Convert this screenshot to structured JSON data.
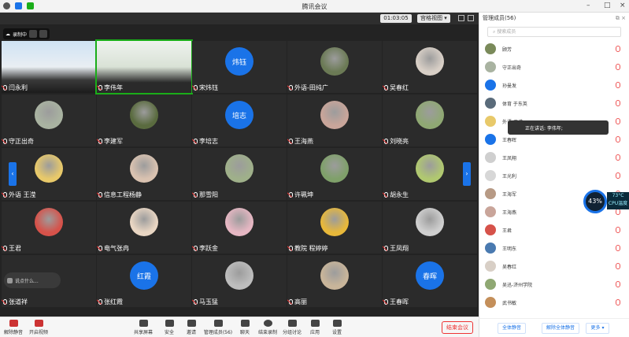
{
  "window": {
    "title": "腾讯会议",
    "timer": "01:03:05",
    "view_label": "宫格视图"
  },
  "recording": {
    "label": "录制中"
  },
  "tiles": [
    {
      "name": "闫永利",
      "type": "video",
      "bg": "video1"
    },
    {
      "name": "李伟年",
      "type": "video",
      "bg": "video2",
      "active": true
    },
    {
      "name": "宋炜钰",
      "type": "text",
      "avatar": "炜钰"
    },
    {
      "name": "外语-田纯广",
      "type": "photo",
      "c": "#6b7a55"
    },
    {
      "name": "吴春红",
      "type": "photo",
      "c": "#d8cfc6"
    },
    {
      "name": "守正出奇",
      "type": "photo",
      "c": "#a9b3a1"
    },
    {
      "name": "李建军",
      "type": "photo",
      "c": "#5a6b3f"
    },
    {
      "name": "李培志",
      "type": "text",
      "avatar": "培志"
    },
    {
      "name": "王海燕",
      "type": "photo",
      "c": "#c9a59a"
    },
    {
      "name": "刘晓亮",
      "type": "photo",
      "c": "#8fa873"
    },
    {
      "name": "外语 王滢",
      "type": "photo",
      "c": "#e8c96a"
    },
    {
      "name": "信息工程杨静",
      "type": "photo",
      "c": "#d9c2b0"
    },
    {
      "name": "那雪阳",
      "type": "photo",
      "c": "#9fb08a"
    },
    {
      "name": "许珮坤",
      "type": "photo",
      "c": "#7fa06a"
    },
    {
      "name": "胡永生",
      "type": "photo",
      "c": "#b0c870"
    },
    {
      "name": "王君",
      "type": "photo",
      "c": "#d6524a"
    },
    {
      "name": "电气张冉",
      "type": "photo",
      "c": "#e9d6c3"
    },
    {
      "name": "李跃金",
      "type": "photo",
      "c": "#e6b7c3"
    },
    {
      "name": "教院 程婷婷",
      "type": "photo",
      "c": "#e8b83a"
    },
    {
      "name": "王凤翔",
      "type": "photo",
      "c": "#cfcfcf"
    },
    {
      "name": "张道祥",
      "type": "blank"
    },
    {
      "name": "张红霞",
      "type": "text",
      "avatar": "红霞"
    },
    {
      "name": "马玉猛",
      "type": "photo",
      "c": "#bdbdbd"
    },
    {
      "name": "高丽",
      "type": "photo",
      "c": "#c9b59a"
    },
    {
      "name": "王春晖",
      "type": "text",
      "avatar": "春晖"
    }
  ],
  "chip": {
    "text": "说点什么..."
  },
  "toolbar": {
    "mute": "解除静音",
    "video": "开启视频",
    "share": "共享屏幕",
    "security": "安全",
    "invite": "邀请",
    "members": "管理成员(56)",
    "chat": "聊天",
    "stop_rec": "结束录制",
    "breakout": "分组讨论",
    "apps": "应用",
    "settings": "设置",
    "end": "结束会议"
  },
  "panel": {
    "title": "管理成员(56)",
    "search_placeholder": "搜索成员",
    "speaking": "正在讲话: 李伟年;",
    "members": [
      {
        "name": "顾芳",
        "c": "#7a8a5a"
      },
      {
        "name": "守正出奇",
        "c": "#a9b3a1"
      },
      {
        "name": "孙曼发",
        "c": "#1a73e8"
      },
      {
        "name": "体育 于东英",
        "c": "#5a6b7a"
      },
      {
        "name": "外语-王滢",
        "c": "#e8c96a"
      },
      {
        "name": "王春晖",
        "c": "#1a73e8"
      },
      {
        "name": "王凤翔",
        "c": "#cfcfcf"
      },
      {
        "name": "王光利",
        "c": "#d7d7d7"
      },
      {
        "name": "王海军",
        "c": "#b79a85"
      },
      {
        "name": "王海燕",
        "c": "#c9a59a"
      },
      {
        "name": "王君",
        "c": "#d6524a"
      },
      {
        "name": "王明东",
        "c": "#4a7ab0"
      },
      {
        "name": "吴春红",
        "c": "#d8cfc6"
      },
      {
        "name": "吴迅-济州学院",
        "c": "#8fa873"
      },
      {
        "name": "武书敏",
        "c": "#c48f5a"
      }
    ],
    "mute_all": "全体静音",
    "unmute_all": "解除全体静音",
    "more": "更多"
  },
  "monitor": {
    "cpu_pct": "43%",
    "temp": "73°C",
    "cpu_label": "CPU温度"
  }
}
